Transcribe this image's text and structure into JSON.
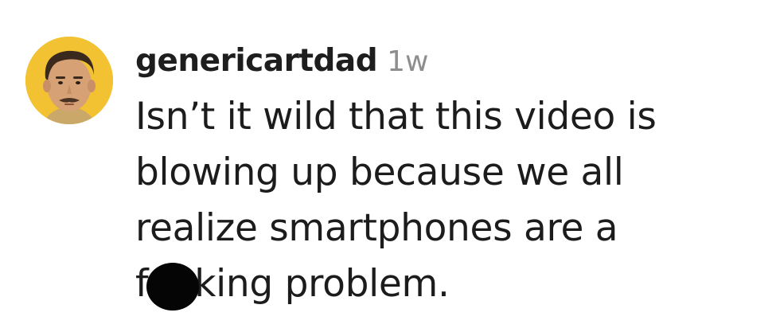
{
  "comment": {
    "author": {
      "username": "genericartdad",
      "timestamp": "1w",
      "avatar_icon": "profile-avatar-man-mustache",
      "avatar_bg": "#f2c232"
    },
    "text_lines": [
      "Isn’t it wild that this video is",
      "blowing up because we all",
      "realize smartphones are a",
      "f",
      "king problem."
    ],
    "censor_mark_color": "#050505"
  }
}
